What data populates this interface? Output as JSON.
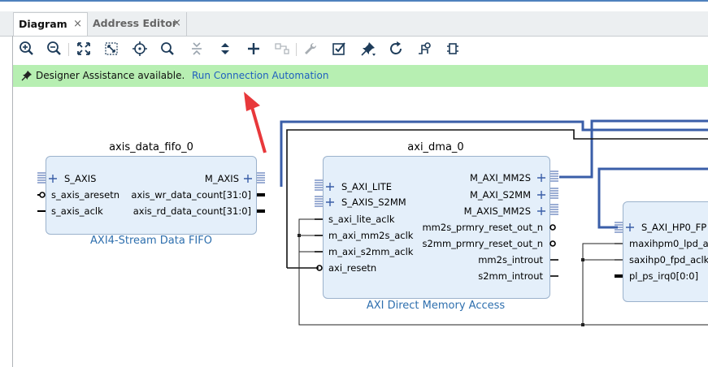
{
  "tabs": [
    {
      "label": "Diagram",
      "close": "×",
      "active": true
    },
    {
      "label": "Address Editor",
      "close": "×",
      "active": false
    }
  ],
  "toolbar": {
    "icons": [
      "zoom-in-icon",
      "zoom-out-icon",
      "zoom-fit-icon",
      "zoom-selection-icon",
      "center-icon",
      "search-icon",
      "collapse-icon",
      "expand-icon",
      "add-ip-icon",
      "make-connection-icon",
      "properties-wrench-icon",
      "validate-design-icon",
      "pin-icon",
      "regenerate-layout-icon",
      "optimize-routing-icon",
      "create-hierarchy-icon"
    ]
  },
  "banner": {
    "message": "Designer Assistance available.",
    "link": "Run Connection Automation"
  },
  "blocks": {
    "fifo": {
      "title": "axis_data_fifo_0",
      "subtitle": "AXI4-Stream Data FIFO",
      "ports_left": [
        "S_AXIS",
        "s_axis_aresetn",
        "s_axis_aclk"
      ],
      "ports_right": [
        "M_AXIS",
        "axis_wr_data_count[31:0]",
        "axis_rd_data_count[31:0]"
      ]
    },
    "dma": {
      "title": "axi_dma_0",
      "subtitle": "AXI Direct Memory Access",
      "ports_left": [
        "S_AXI_LITE",
        "S_AXIS_S2MM",
        "s_axi_lite_aclk",
        "m_axi_mm2s_aclk",
        "m_axi_s2mm_aclk",
        "axi_resetn"
      ],
      "ports_right": [
        "M_AXI_MM2S",
        "M_AXI_S2MM",
        "M_AXIS_MM2S",
        "mm2s_prmry_reset_out_n",
        "s2mm_prmry_reset_out_n",
        "mm2s_introut",
        "s2mm_introut"
      ]
    },
    "ps": {
      "ports_left": [
        "S_AXI_HP0_FP",
        "maxihpm0_lpd_ac",
        "saxihp0_fpd_aclk",
        "pl_ps_irq0[0:0]"
      ]
    }
  },
  "colors": {
    "bus": "#3a5ea8",
    "net": "#111111",
    "banner_bg": "#b7efb2",
    "block_fill": "#e4effa",
    "subtitle": "#2e6fae",
    "link": "#1f5fbf",
    "arrow": "#e8383b"
  }
}
